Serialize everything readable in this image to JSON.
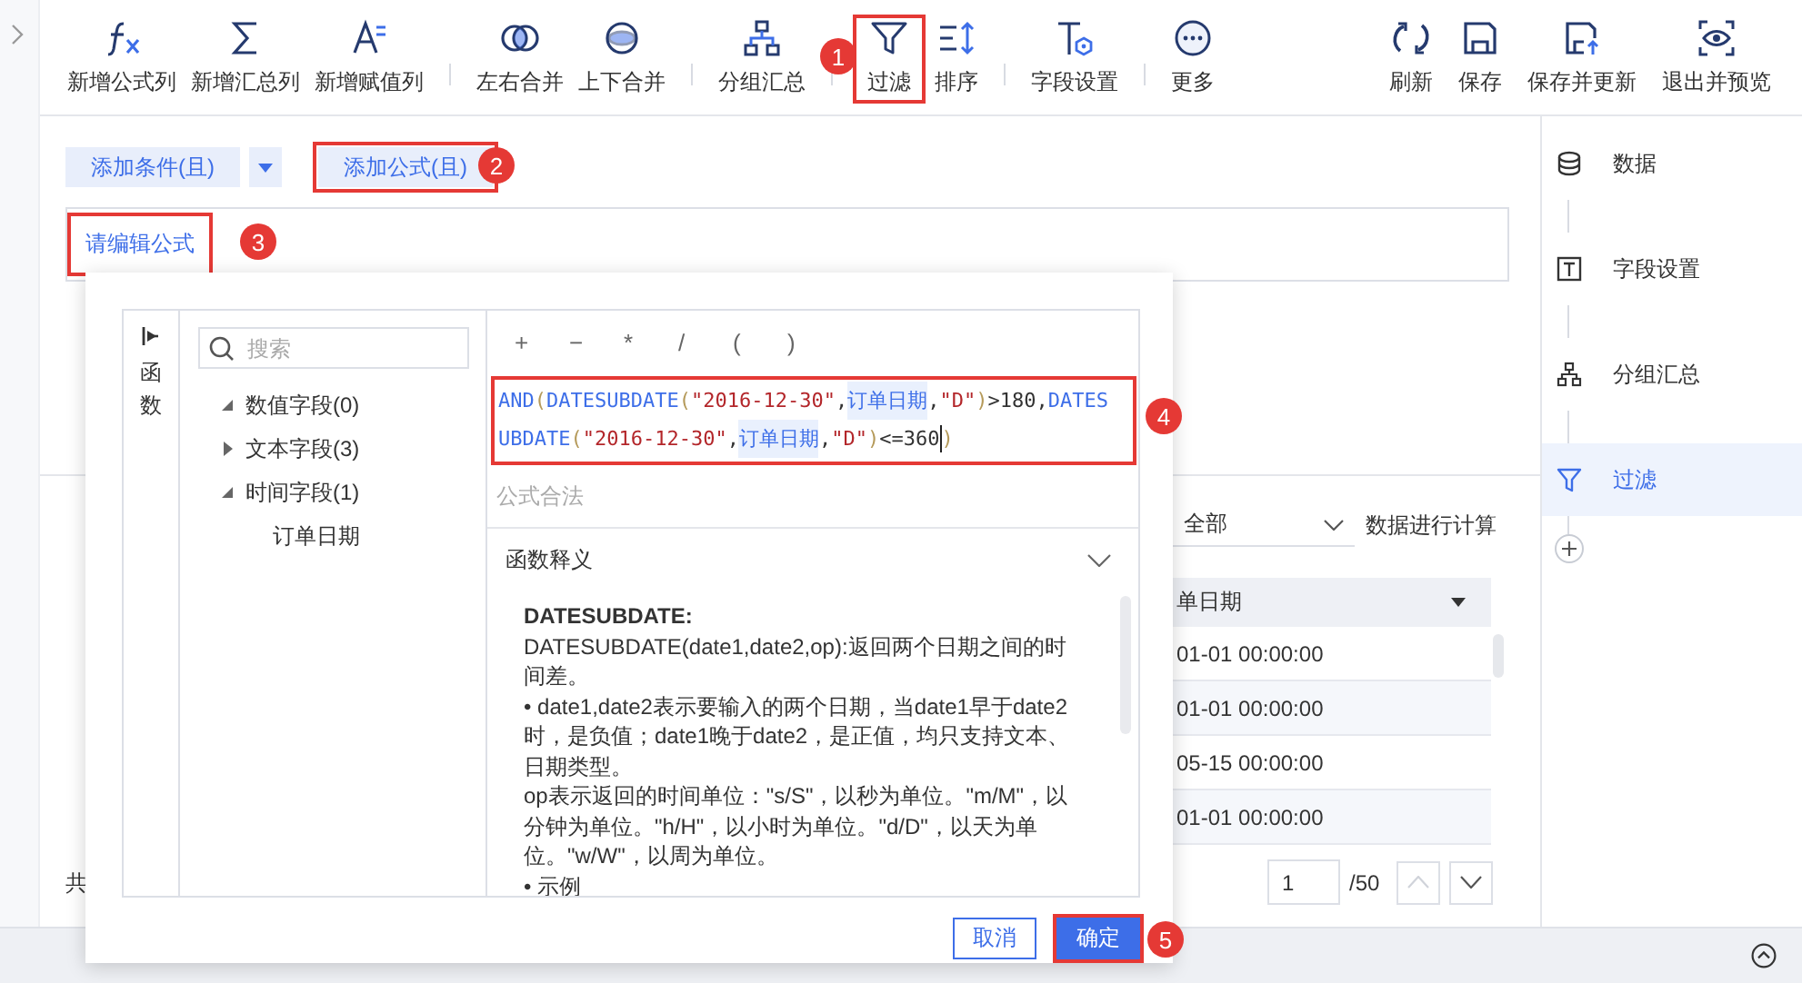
{
  "toolbar": {
    "left": [
      {
        "kind": "button",
        "label": "新增公式列",
        "highlighted": false
      },
      {
        "kind": "button",
        "label": "新增汇总列",
        "highlighted": false
      },
      {
        "kind": "button",
        "label": "新增赋值列",
        "highlighted": false
      },
      {
        "kind": "separator"
      },
      {
        "kind": "button",
        "label": "左右合并",
        "highlighted": false
      },
      {
        "kind": "button",
        "label": "上下合并",
        "highlighted": false
      },
      {
        "kind": "separator"
      },
      {
        "kind": "button",
        "label": "分组汇总",
        "highlighted": false
      },
      {
        "kind": "separator"
      },
      {
        "kind": "button",
        "label": "过滤",
        "highlighted": true
      },
      {
        "kind": "button",
        "label": "排序",
        "highlighted": false
      },
      {
        "kind": "separator"
      },
      {
        "kind": "button",
        "label": "字段设置",
        "highlighted": false
      },
      {
        "kind": "separator"
      },
      {
        "kind": "button",
        "label": "更多",
        "highlighted": false
      }
    ],
    "right": [
      {
        "kind": "button",
        "label": "刷新",
        "highlighted": false
      },
      {
        "kind": "button",
        "label": "保存",
        "highlighted": false
      },
      {
        "kind": "button",
        "label": "保存并更新",
        "highlighted": false
      },
      {
        "kind": "button",
        "label": "退出并预览",
        "highlighted": false
      }
    ]
  },
  "filter_buttons": [
    {
      "label": "添加条件(且)",
      "highlighted": false,
      "has_dropdown": true
    },
    {
      "label": "添加公式(且)",
      "highlighted": true,
      "has_dropdown": false
    }
  ],
  "formula_field": {
    "link": "请编辑公式",
    "highlighted": true
  },
  "calculation": {
    "scope": "全部",
    "suffix": "数据进行计算"
  },
  "table": {
    "columns": [
      "单日期"
    ],
    "rows": [
      [
        "01-01 00:00:00"
      ],
      [
        "01-01 00:00:00"
      ],
      [
        "05-15 00:00:00"
      ],
      [
        "01-01 00:00:00"
      ]
    ]
  },
  "footer_text": "共",
  "pagination": {
    "page": "1",
    "total": "/50",
    "prev_disabled": true,
    "next_disabled": false
  },
  "steps": [
    {
      "label": "数据",
      "selected": false
    },
    {
      "label": "字段设置",
      "selected": false
    },
    {
      "label": "分组汇总",
      "selected": false
    },
    {
      "label": "过滤",
      "selected": true
    }
  ],
  "dialog": {
    "side_tab": "函数",
    "search": {
      "placeholder": "搜索"
    },
    "field_tree": [
      {
        "label": "数值字段(0)",
        "expanded": true
      },
      {
        "label": "文本字段(3)",
        "expanded": false
      },
      {
        "label": "时间字段(1)",
        "expanded": true,
        "children": [
          {
            "label": "订单日期"
          }
        ]
      }
    ],
    "operators": [
      "+",
      "−",
      "*",
      "/",
      "(",
      ")"
    ],
    "formula": {
      "highlighted": true,
      "lines": [
        [
          {
            "kind": "function",
            "text": "AND"
          },
          {
            "kind": "paren",
            "text": "("
          },
          {
            "kind": "function",
            "text": "DATESUBDATE"
          },
          {
            "kind": "paren",
            "text": "("
          },
          {
            "kind": "string",
            "text": "\"2016-12-30\""
          },
          {
            "kind": "plain",
            "text": ","
          },
          {
            "kind": "field",
            "text": "订单日期"
          },
          {
            "kind": "plain",
            "text": ","
          },
          {
            "kind": "string",
            "text": "\"D\""
          },
          {
            "kind": "paren",
            "text": ")"
          },
          {
            "kind": "plain",
            "text": ">180,"
          },
          {
            "kind": "function",
            "text": "DATES"
          }
        ],
        [
          {
            "kind": "function",
            "text": "UBDATE"
          },
          {
            "kind": "paren",
            "text": "("
          },
          {
            "kind": "string",
            "text": "\"2016-12-30\""
          },
          {
            "kind": "plain",
            "text": ","
          },
          {
            "kind": "field",
            "text": "订单日期"
          },
          {
            "kind": "plain",
            "text": ","
          },
          {
            "kind": "string",
            "text": "\"D\""
          },
          {
            "kind": "paren",
            "text": ")"
          },
          {
            "kind": "plain",
            "text": "<=360"
          },
          {
            "kind": "paren",
            "text": ")"
          }
        ]
      ]
    },
    "status": "公式合法",
    "help": {
      "title": "函数释义",
      "expanded": true,
      "heading": "DATESUBDATE:",
      "paragraphs": [
        "DATESUBDATE(date1,date2,op):返回两个日期之间的时间差。",
        "•  date1,date2表示要输入的两个日期，当date1早于date2时，是负值；date1晚于date2，是正值，均只支持文本、日期类型。",
        "op表示返回的时间单位：\"s/S\"，以秒为单位。\"m/M\"，以分钟为单位。\"h/H\"，以小时为单位。\"d/D\"，以天为单位。\"w/W\"，以周为单位。",
        "•  示例"
      ]
    },
    "buttons": [
      {
        "label": "取消",
        "kind": "secondary",
        "highlighted": false
      },
      {
        "label": "确定",
        "kind": "primary",
        "highlighted": true
      }
    ]
  },
  "annotations": [
    {
      "number": "1"
    },
    {
      "number": "2"
    },
    {
      "number": "3"
    },
    {
      "number": "4"
    },
    {
      "number": "5"
    }
  ]
}
